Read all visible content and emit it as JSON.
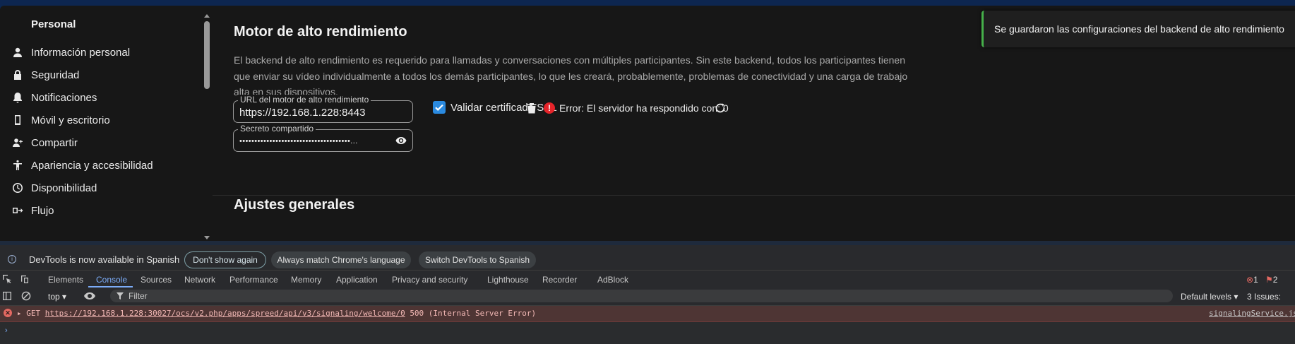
{
  "sidebar": {
    "heading": "Personal",
    "items": [
      {
        "label": "Información personal",
        "icon": "person-icon"
      },
      {
        "label": "Seguridad",
        "icon": "lock-icon"
      },
      {
        "label": "Notificaciones",
        "icon": "bell-icon"
      },
      {
        "label": "Móvil y escritorio",
        "icon": "phone-icon"
      },
      {
        "label": "Compartir",
        "icon": "share-person-icon"
      },
      {
        "label": "Apariencia y accesibilidad",
        "icon": "accessibility-icon"
      },
      {
        "label": "Disponibilidad",
        "icon": "clock-icon"
      },
      {
        "label": "Flujo",
        "icon": "flow-icon"
      }
    ]
  },
  "hpb": {
    "title": "Motor de alto rendimiento",
    "description": "El backend de alto rendimiento es requerido para llamadas y conversaciones con múltiples participantes. Sin este backend, todos los participantes tienen que enviar su vídeo individualmente a todos los demás participantes, lo que les creará, probablemente, problemas de conectividad y una carga de trabajo alta en sus dispositivos.",
    "url_label": "URL del motor de alto rendimiento",
    "url_value": "https://192.168.1.228:8443",
    "ssl_label": "Validar certificado SSL",
    "ssl_checked": true,
    "error_text": "Error: El servidor ha respondido con: 0",
    "secret_label": "Secreto compartido",
    "secret_value": "•••••••••••••••••••••••••••••••••••••..."
  },
  "general": {
    "title": "Ajustes generales"
  },
  "toast": {
    "text": "Se guardaron las configuraciones del backend de alto rendimiento"
  },
  "devtools": {
    "info_text": "DevTools is now available in Spanish",
    "dont_show": "Don't show again",
    "match_lang": "Always match Chrome's language",
    "switch_lang": "Switch DevTools to Spanish",
    "tabs": [
      "Elements",
      "Console",
      "Sources",
      "Network",
      "Performance",
      "Memory",
      "Application",
      "Privacy and security",
      "Lighthouse",
      "Recorder",
      "AdBlock"
    ],
    "active_tab": "Console",
    "error_count": "1",
    "issue_count": "2",
    "context": "top",
    "filter_placeholder": "Filter",
    "levels": "Default levels",
    "issues": "3 Issues:",
    "log": {
      "method": "GET",
      "url": "https://192.168.1.228:30027/ocs/v2.php/apps/spreed/api/v3/signaling/welcome/0",
      "status": "500 (Internal Server Error)",
      "source": "signalingService.js"
    },
    "prompt": "›"
  },
  "colors": {
    "accent": "#2a8ae0",
    "error": "#e5242a",
    "success": "#46b04a",
    "devtools_accent": "#7cacf8"
  }
}
